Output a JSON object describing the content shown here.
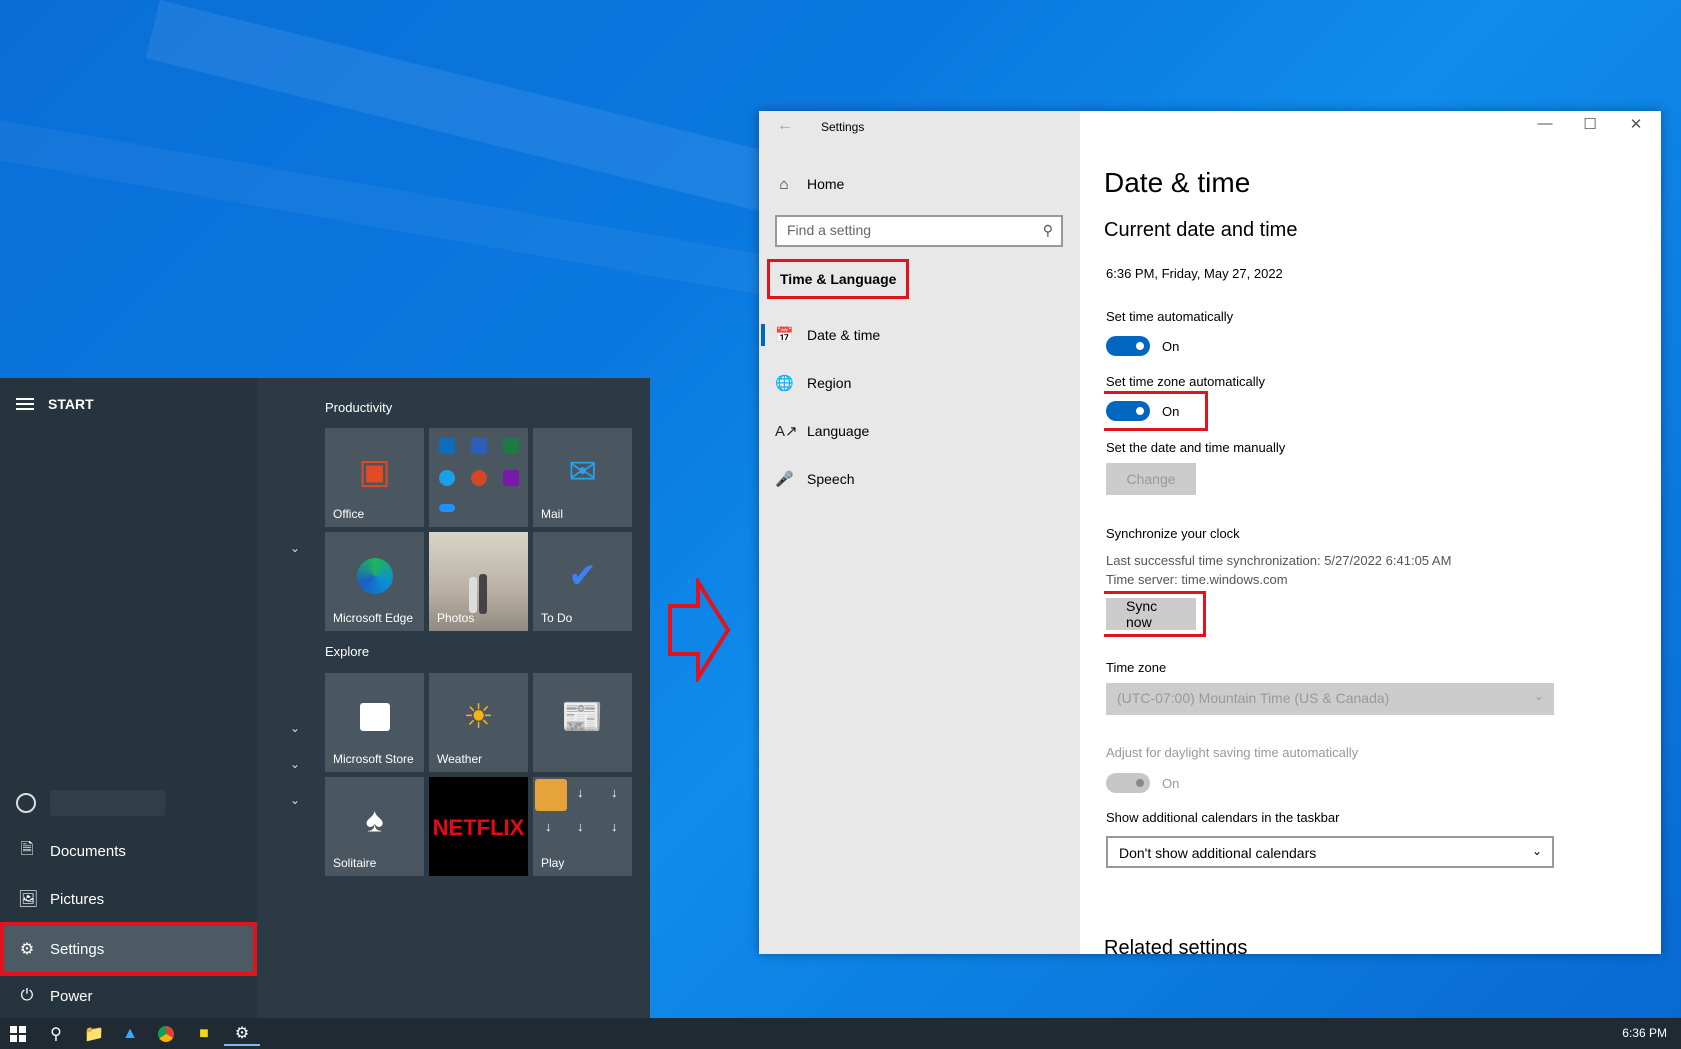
{
  "start_menu": {
    "header": "START",
    "items": [
      {
        "label": "Documents",
        "icon": "document-icon"
      },
      {
        "label": "Pictures",
        "icon": "pictures-icon"
      },
      {
        "label": "Settings",
        "icon": "gear-icon"
      },
      {
        "label": "Power",
        "icon": "power-icon"
      }
    ],
    "groups": [
      {
        "title": "Productivity"
      },
      {
        "title": "Explore"
      }
    ],
    "tiles": [
      {
        "label": "Office"
      },
      {
        "label": ""
      },
      {
        "label": "Mail"
      },
      {
        "label": "Microsoft Edge"
      },
      {
        "label": "Photos"
      },
      {
        "label": "To Do"
      },
      {
        "label": "Microsoft Store"
      },
      {
        "label": "Weather"
      },
      {
        "label": ""
      },
      {
        "label": "Solitaire"
      },
      {
        "label": "NETFLIX"
      },
      {
        "label": "Play"
      }
    ]
  },
  "settings": {
    "title": "Settings",
    "home": "Home",
    "search_placeholder": "Find a setting",
    "section": "Time & Language",
    "nav": [
      {
        "label": "Date & time"
      },
      {
        "label": "Region"
      },
      {
        "label": "Language"
      },
      {
        "label": "Speech"
      }
    ],
    "content": {
      "page_title": "Date & time",
      "subtitle": "Current date and time",
      "current_datetime": "6:36 PM, Friday, May 27, 2022",
      "set_time_auto_label": "Set time automatically",
      "set_time_auto_state": "On",
      "set_tz_auto_label": "Set time zone automatically",
      "set_tz_auto_state": "On",
      "manual_label": "Set the date and time manually",
      "change_button": "Change",
      "sync_heading": "Synchronize your clock",
      "last_sync": "Last successful time synchronization: 5/27/2022 6:41:05 AM",
      "time_server": "Time server: time.windows.com",
      "sync_button": "Sync now",
      "timezone_label": "Time zone",
      "timezone_value": "(UTC-07:00) Mountain Time (US & Canada)",
      "dst_label": "Adjust for daylight saving time automatically",
      "dst_state": "On",
      "calendars_label": "Show additional calendars in the taskbar",
      "calendars_value": "Don't show additional calendars",
      "related": "Related settings"
    }
  },
  "taskbar": {
    "clock": "6:36 PM"
  },
  "colors": {
    "accent": "#0067c0",
    "highlight_red": "#e0141e"
  }
}
